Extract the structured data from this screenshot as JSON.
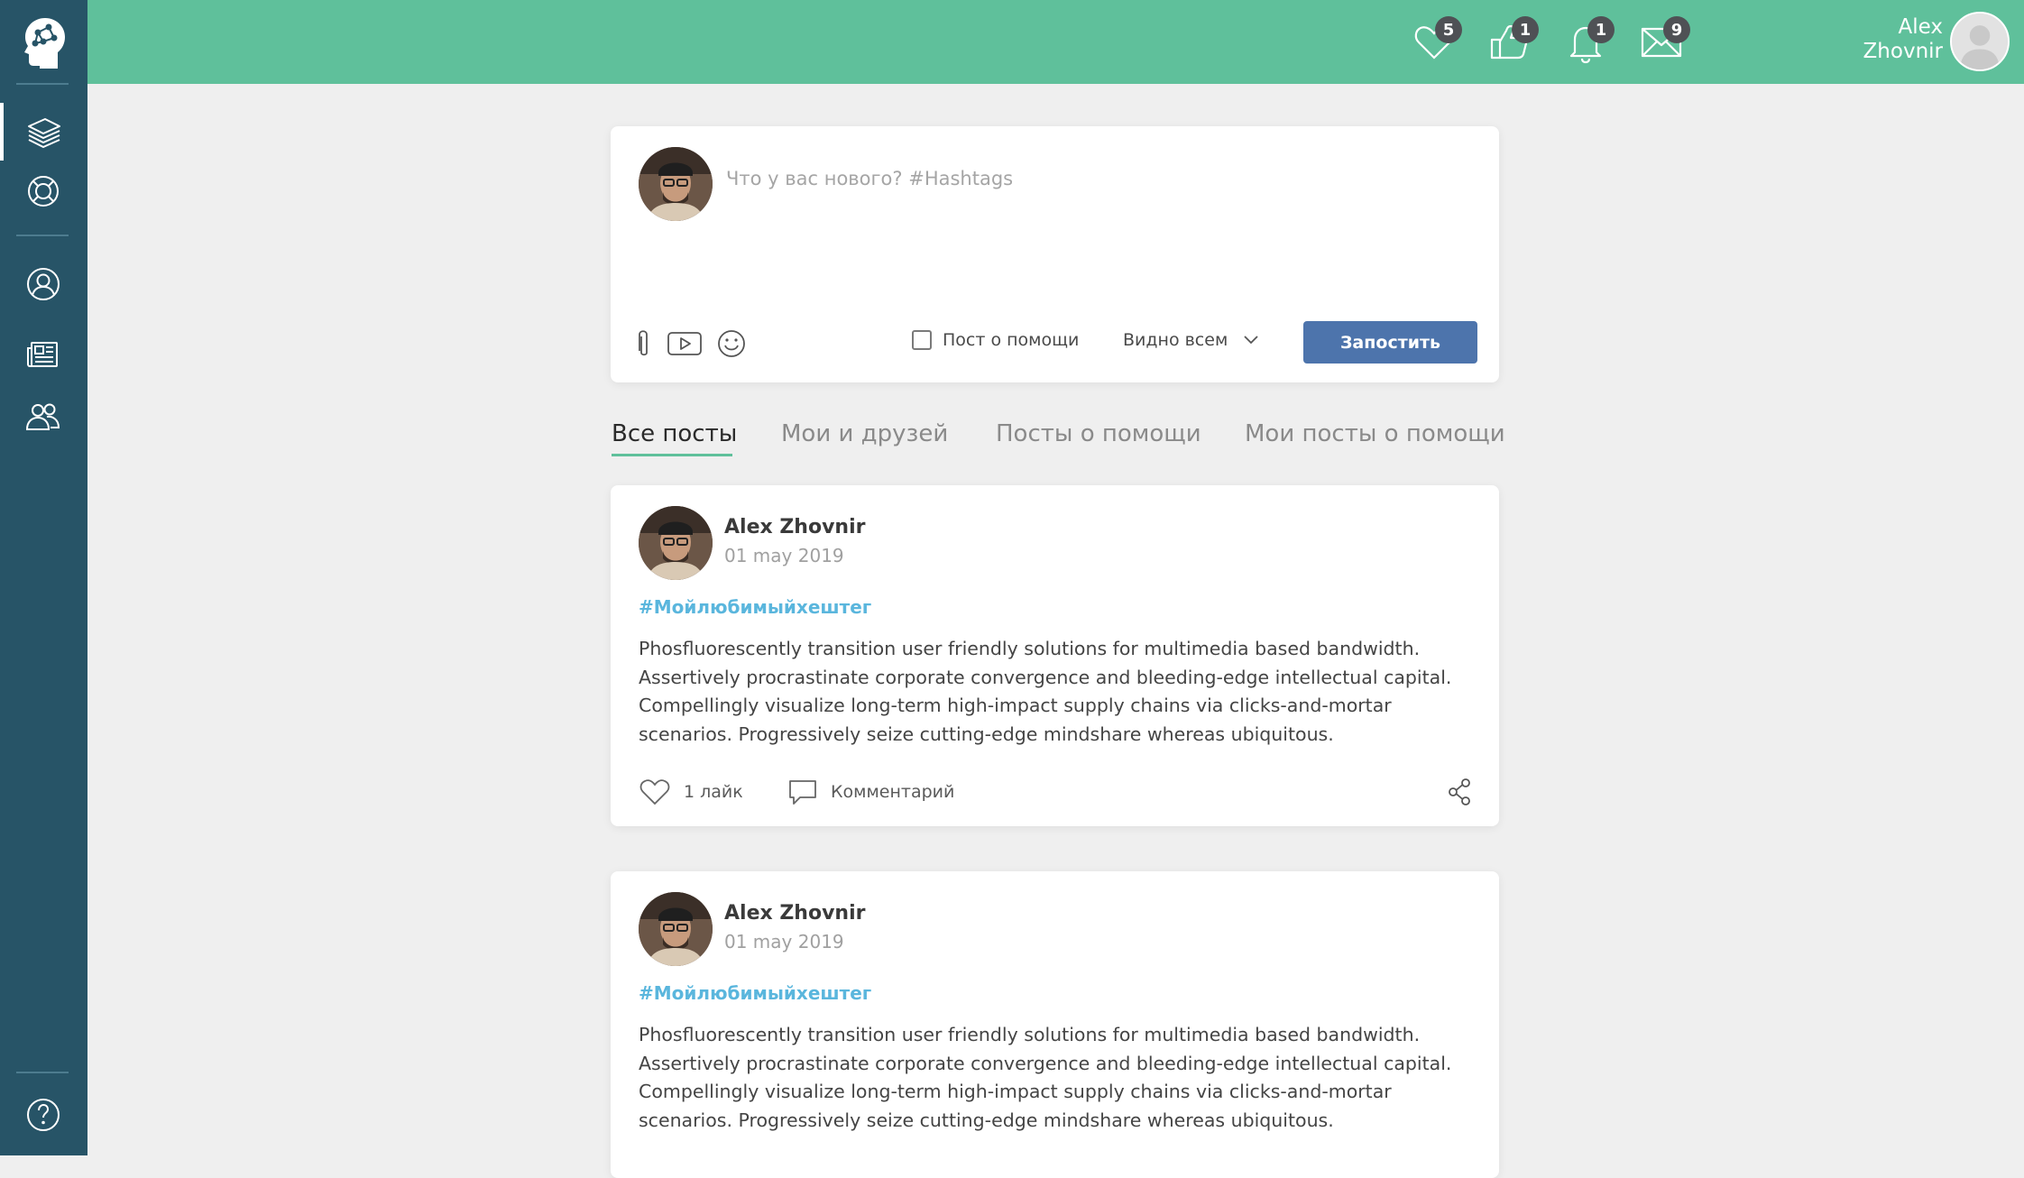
{
  "app": {
    "accent_color": "#5fc09b",
    "sidebar_color": "#275467",
    "primary_button_color": "#4d74ac",
    "hashtag_color": "#5ab6dd"
  },
  "sidebar": {
    "items": [
      {
        "icon": "layers-icon",
        "active": true
      },
      {
        "icon": "lifebuoy-icon",
        "active": false
      },
      {
        "icon": "user-icon",
        "active": false
      },
      {
        "icon": "newspaper-icon",
        "active": false
      },
      {
        "icon": "group-icon",
        "active": false
      }
    ],
    "footer_icon": "help-icon"
  },
  "header": {
    "notifications": [
      {
        "icon": "heart-icon",
        "count": "5"
      },
      {
        "icon": "thumbs-up-icon",
        "count": "1"
      },
      {
        "icon": "bell-icon",
        "count": "1"
      },
      {
        "icon": "mail-icon",
        "count": "9"
      }
    ],
    "user": {
      "first_name": "Alex",
      "last_name": "Zhovnir"
    }
  },
  "composer": {
    "placeholder": "Что у вас нового? #Hashtags",
    "help_post_label": "Пост о помощи",
    "visibility_label": "Видно всем",
    "submit_label": "Запостить"
  },
  "tabs": [
    {
      "label": "Все посты",
      "active": true
    },
    {
      "label": "Мои и друзей",
      "active": false
    },
    {
      "label": "Посты о помощи",
      "active": false
    },
    {
      "label": "Мои посты о помощи",
      "active": false
    }
  ],
  "posts": [
    {
      "author": "Alex Zhovnir",
      "date": "01 may 2019",
      "hashtag": "#Мойлюбимыйхештег",
      "body": "Phosfluorescently transition user friendly solutions for multimedia based bandwidth. Assertively procrastinate corporate convergence and bleeding-edge intellectual capital. Compellingly visualize long-term high-impact supply chains via clicks-and-mortar scenarios. Progressively seize cutting-edge mindshare whereas ubiquitous.",
      "likes_label": "1 лайк",
      "comment_label": "Комментарий"
    },
    {
      "author": "Alex Zhovnir",
      "date": "01 may 2019",
      "hashtag": "#Мойлюбимыйхештег",
      "body": "Phosfluorescently transition user friendly solutions for multimedia based bandwidth. Assertively procrastinate corporate convergence and bleeding-edge intellectual capital. Compellingly visualize long-term high-impact supply chains via clicks-and-mortar scenarios. Progressively seize cutting-edge mindshare whereas ubiquitous."
    }
  ]
}
